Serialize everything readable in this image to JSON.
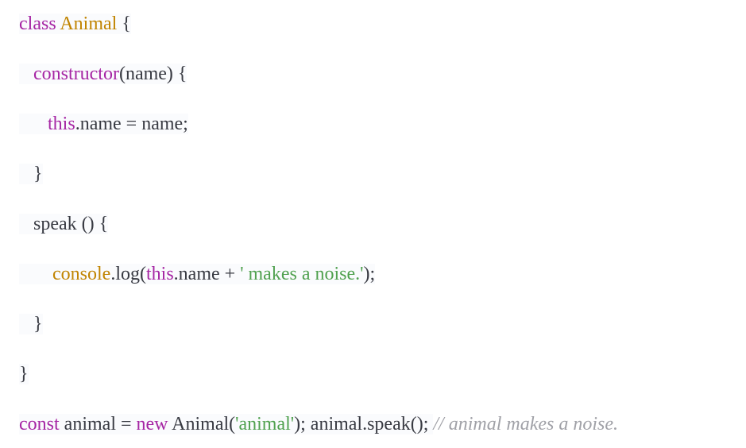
{
  "code_block": {
    "language": "javascript",
    "lines": [
      {
        "tokens": [
          {
            "t": "class",
            "k": "keyword"
          },
          {
            "t": " ",
            "k": "text"
          },
          {
            "t": "Animal",
            "k": "class-name"
          },
          {
            "t": " {",
            "k": "text"
          }
        ]
      },
      {
        "tokens": [
          {
            "t": "   ",
            "k": "text"
          },
          {
            "t": "constructor",
            "k": "keyword"
          },
          {
            "t": "(name) {",
            "k": "text"
          }
        ]
      },
      {
        "tokens": [
          {
            "t": "      ",
            "k": "text"
          },
          {
            "t": "this",
            "k": "keyword"
          },
          {
            "t": ".name = name;",
            "k": "text"
          }
        ]
      },
      {
        "tokens": [
          {
            "t": "   }",
            "k": "text"
          }
        ]
      },
      {
        "tokens": [
          {
            "t": "   speak () {",
            "k": "text"
          }
        ]
      },
      {
        "tokens": [
          {
            "t": "       ",
            "k": "text"
          },
          {
            "t": "console",
            "k": "class-name"
          },
          {
            "t": ".log(",
            "k": "text"
          },
          {
            "t": "this",
            "k": "keyword"
          },
          {
            "t": ".name + ",
            "k": "text"
          },
          {
            "t": "' makes a noise.'",
            "k": "string"
          },
          {
            "t": ");",
            "k": "text"
          }
        ]
      },
      {
        "tokens": [
          {
            "t": "   }",
            "k": "text"
          }
        ]
      },
      {
        "tokens": [
          {
            "t": "}",
            "k": "text"
          }
        ]
      },
      {
        "tokens": [
          {
            "t": "const",
            "k": "keyword"
          },
          {
            "t": " animal = ",
            "k": "text"
          },
          {
            "t": "new",
            "k": "keyword"
          },
          {
            "t": " Animal(",
            "k": "text"
          },
          {
            "t": "'animal'",
            "k": "string"
          },
          {
            "t": "); animal.speak(); ",
            "k": "text"
          },
          {
            "t": "// animal makes a noise.",
            "k": "comment"
          }
        ]
      }
    ]
  },
  "colors": {
    "keyword": "#a626a4",
    "class-name": "#c18401",
    "string": "#50a14f",
    "comment": "#a0a1a7",
    "text": "#383a42",
    "line-background": "#fafbfd"
  }
}
